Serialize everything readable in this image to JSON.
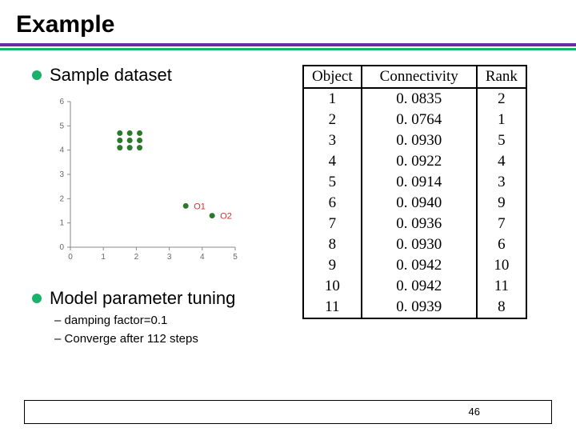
{
  "title": "Example",
  "left": {
    "bullet1": "Sample dataset",
    "bullet2": "Model parameter tuning",
    "sub1": "damping factor=0.1",
    "sub2": "Converge after 112 steps"
  },
  "table": {
    "headers": [
      "Object",
      "Connectivity",
      "Rank"
    ],
    "rows": [
      [
        "1",
        "0. 0835",
        "2"
      ],
      [
        "2",
        "0. 0764",
        "1"
      ],
      [
        "3",
        "0. 0930",
        "5"
      ],
      [
        "4",
        "0. 0922",
        "4"
      ],
      [
        "5",
        "0. 0914",
        "3"
      ],
      [
        "6",
        "0. 0940",
        "9"
      ],
      [
        "7",
        "0. 0936",
        "7"
      ],
      [
        "8",
        "0. 0930",
        "6"
      ],
      [
        "9",
        "0. 0942",
        "10"
      ],
      [
        "10",
        "0. 0942",
        "11"
      ],
      [
        "11",
        "0. 0939",
        "8"
      ]
    ]
  },
  "page_number": "46",
  "chart_data": {
    "type": "scatter",
    "xlabel": "",
    "ylabel": "",
    "xlim": [
      0,
      5
    ],
    "ylim": [
      0,
      6
    ],
    "xticks": [
      0,
      1,
      2,
      3,
      4,
      5
    ],
    "yticks": [
      0,
      1,
      2,
      3,
      4,
      5,
      6
    ],
    "series": [
      {
        "name": "cluster",
        "color": "#2b7a2b",
        "points": [
          {
            "x": 1.5,
            "y": 4.7
          },
          {
            "x": 1.8,
            "y": 4.7
          },
          {
            "x": 2.1,
            "y": 4.7
          },
          {
            "x": 1.5,
            "y": 4.4
          },
          {
            "x": 1.8,
            "y": 4.4
          },
          {
            "x": 2.1,
            "y": 4.4
          },
          {
            "x": 1.5,
            "y": 4.1
          },
          {
            "x": 1.8,
            "y": 4.1
          },
          {
            "x": 2.1,
            "y": 4.1
          }
        ]
      },
      {
        "name": "O1",
        "color": "#2b7a2b",
        "label": "O1",
        "points": [
          {
            "x": 3.5,
            "y": 1.7
          }
        ]
      },
      {
        "name": "O2",
        "color": "#2b7a2b",
        "label": "O2",
        "points": [
          {
            "x": 4.3,
            "y": 1.3
          }
        ]
      }
    ]
  }
}
